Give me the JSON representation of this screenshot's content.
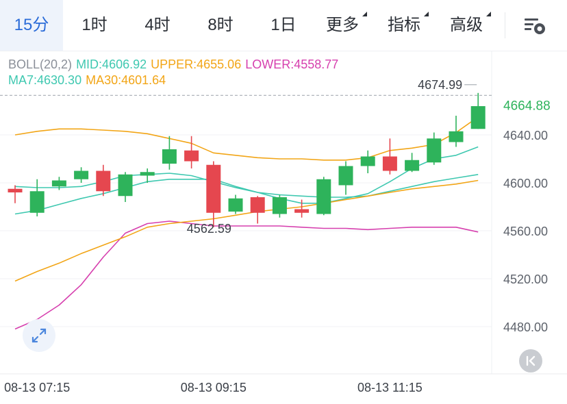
{
  "tabs": [
    {
      "label": "15分",
      "active": true
    },
    {
      "label": "1时",
      "active": false
    },
    {
      "label": "4时",
      "active": false
    },
    {
      "label": "8时",
      "active": false
    },
    {
      "label": "1日",
      "active": false
    },
    {
      "label": "更多",
      "active": false,
      "dropdown": true
    },
    {
      "label": "指标",
      "active": false,
      "dropdown": true
    },
    {
      "label": "高级",
      "active": false,
      "dropdown": true
    }
  ],
  "settings_icon": "chart-settings-icon",
  "legend": {
    "boll": {
      "name": "BOLL(20,2)",
      "mid": "MID:4606.92",
      "upper": "UPPER:4655.06",
      "lower": "LOWER:4558.77"
    },
    "ma": {
      "ma7": "MA7:4630.30",
      "ma30": "MA30:4601.64"
    }
  },
  "colors": {
    "up": "#2eb35b",
    "down": "#e5474f",
    "boll_mid": "#2c3e50",
    "upper": "#f2a516",
    "lower": "#d63fae",
    "ma7": "#3ec8b0",
    "ma30": "#f2a516",
    "current_price": "#2eb35b",
    "active_tab": "#2a6bd8"
  },
  "chart_data": {
    "type": "candlestick",
    "y_ticks": [
      "4640.00",
      "4600.00",
      "4560.00",
      "4520.00",
      "4480.00"
    ],
    "ylim": [
      4458,
      4700
    ],
    "x_ticks": [
      "08-13 07:15",
      "08-13 09:15",
      "08-13 11:15"
    ],
    "x_tick_index": [
      1,
      9,
      17
    ],
    "max_label": "4674.99",
    "min_label": "4562.59",
    "current_price": "4664.88",
    "candles": [
      {
        "o": 4595,
        "c": 4592,
        "h": 4598,
        "l": 4583
      },
      {
        "o": 4575,
        "c": 4593,
        "h": 4603,
        "l": 4572
      },
      {
        "o": 4597,
        "c": 4602,
        "h": 4605,
        "l": 4594
      },
      {
        "o": 4603,
        "c": 4610,
        "h": 4613,
        "l": 4600
      },
      {
        "o": 4610,
        "c": 4593,
        "h": 4615,
        "l": 4589
      },
      {
        "o": 4589,
        "c": 4607,
        "h": 4609,
        "l": 4584
      },
      {
        "o": 4606,
        "c": 4609,
        "h": 4612,
        "l": 4600
      },
      {
        "o": 4616,
        "c": 4628,
        "h": 4639,
        "l": 4611
      },
      {
        "o": 4627,
        "c": 4618,
        "h": 4639,
        "l": 4612
      },
      {
        "o": 4615,
        "c": 4575,
        "h": 4618,
        "l": 4563
      },
      {
        "o": 4576,
        "c": 4587,
        "h": 4590,
        "l": 4574
      },
      {
        "o": 4588,
        "c": 4575,
        "h": 4589,
        "l": 4566
      },
      {
        "o": 4574,
        "c": 4588,
        "h": 4590,
        "l": 4571
      },
      {
        "o": 4578,
        "c": 4575,
        "h": 4586,
        "l": 4571
      },
      {
        "o": 4574,
        "c": 4603,
        "h": 4605,
        "l": 4573
      },
      {
        "o": 4598,
        "c": 4614,
        "h": 4618,
        "l": 4590
      },
      {
        "o": 4614,
        "c": 4622,
        "h": 4627,
        "l": 4608
      },
      {
        "o": 4622,
        "c": 4610,
        "h": 4637,
        "l": 4607
      },
      {
        "o": 4610,
        "c": 4619,
        "h": 4625,
        "l": 4609
      },
      {
        "o": 4617,
        "c": 4637,
        "h": 4642,
        "l": 4615
      },
      {
        "o": 4634,
        "c": 4643,
        "h": 4656,
        "l": 4630
      },
      {
        "o": 4645,
        "c": 4664,
        "h": 4675,
        "l": 4645
      }
    ],
    "series": [
      {
        "key": "mid",
        "values": [
          4597,
          4596,
          4596,
          4597,
          4601,
          4606,
          4607,
          4608,
          4606,
          4601,
          4596,
          4592,
          4590,
          4589,
          4588,
          4588,
          4589,
          4593,
          4597,
          4601,
          4604,
          4607
        ]
      },
      {
        "key": "upper",
        "values": [
          4640,
          4643,
          4645,
          4645,
          4644,
          4643,
          4641,
          4637,
          4633,
          4625,
          4623,
          4621,
          4620,
          4620,
          4619,
          4619,
          4621,
          4627,
          4629,
          4632,
          4642,
          4655
        ]
      },
      {
        "key": "lower",
        "values": [
          4478,
          4486,
          4498,
          4515,
          4538,
          4558,
          4566,
          4568,
          4566,
          4564,
          4564,
          4564,
          4564,
          4563,
          4562,
          4562,
          4561,
          4562,
          4563,
          4563,
          4563,
          4559
        ]
      },
      {
        "key": "ma7",
        "values": [
          4574,
          4577,
          4582,
          4587,
          4591,
          4596,
          4601,
          4603,
          4603,
          4603,
          4597,
          4592,
          4587,
          4583,
          4583,
          4587,
          4591,
          4601,
          4612,
          4620,
          4623,
          4630
        ]
      },
      {
        "key": "ma30",
        "values": [
          4518,
          4526,
          4533,
          4541,
          4548,
          4555,
          4563,
          4566,
          4568,
          4570,
          4573,
          4576,
          4578,
          4580,
          4583,
          4586,
          4589,
          4592,
          4595,
          4597,
          4599,
          4602
        ]
      }
    ]
  }
}
